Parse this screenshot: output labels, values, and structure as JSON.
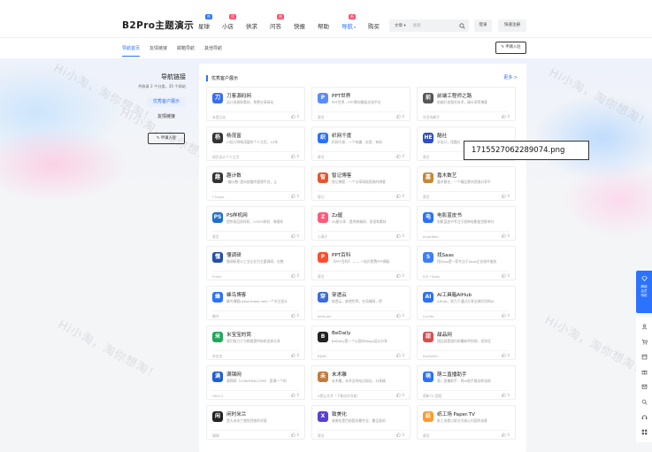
{
  "header": {
    "logo": "B2Pro主题演示",
    "nav": [
      {
        "label": "星球",
        "badge": "热门",
        "badge_color": "#2a72ff",
        "caret": false,
        "active": false
      },
      {
        "label": "小店",
        "badge": "优惠",
        "badge_color": "#ff4d6a",
        "caret": false,
        "active": false
      },
      {
        "label": "供求",
        "badge": "",
        "badge_color": "",
        "caret": false,
        "active": false
      },
      {
        "label": "问答",
        "badge": "热门",
        "badge_color": "#ff4d6a",
        "caret": false,
        "active": false
      },
      {
        "label": "快报",
        "badge": "",
        "badge_color": "",
        "caret": false,
        "active": false
      },
      {
        "label": "帮助",
        "badge": "",
        "badge_color": "",
        "caret": false,
        "active": false
      },
      {
        "label": "导航",
        "badge": "新",
        "badge_color": "#ff4d6a",
        "caret": true,
        "active": true
      },
      {
        "label": "购买",
        "badge": "",
        "badge_color": "",
        "caret": false,
        "active": false
      }
    ],
    "search_scope": "文章",
    "search_placeholder": "搜索",
    "login": "登录",
    "register": "快速注册"
  },
  "subnav": {
    "tabs": [
      "导航首页",
      "友情链接",
      "邮箱导航",
      "其他导航"
    ],
    "active_index": 0,
    "apply": "申请入驻"
  },
  "sidebar": {
    "title": "导航链接",
    "subtitle": "共收录 2 个分类，35 个网站",
    "items": [
      "优秀客户展示",
      "友情链接"
    ],
    "active_index": 0,
    "apply": "申请入驻"
  },
  "main": {
    "section_title": "优秀客户展示",
    "more": "更多 >",
    "cards": [
      {
        "title": "刀客源码网",
        "desc": "设计资源和素材，免费分享网站",
        "author": "未登记名",
        "likes": "0",
        "logo_text": "刀",
        "logo_color": "#3a6df0"
      },
      {
        "title": "PPT世界",
        "desc": "PPT世界 - PPT素材模板交流平台",
        "author": "慕言",
        "likes": "0",
        "logo_text": "P",
        "logo_color": "#5b8cff"
      },
      {
        "title": "前端工程师之路",
        "desc": "前端开发相关技术，精分享等博客",
        "author": "空灵的鹤子",
        "likes": "0",
        "logo_text": "前",
        "logo_color": "#555555"
      },
      {
        "title": "杨茂富",
        "desc": "UI设计师杨茂富的个人主页，10年",
        "author": "网页设计个人主页",
        "likes": "0",
        "logo_text": "杨",
        "logo_color": "#333333"
      },
      {
        "title": "织网千度",
        "desc": "织网千度 - 一个有趣、实用、有料",
        "author": "慕言",
        "likes": "0",
        "logo_text": "织",
        "logo_color": "#2a72ff"
      },
      {
        "title": "酷社",
        "desc": "学设计，找酷社",
        "author": "慕言",
        "likes": "0",
        "logo_text": "HE",
        "logo_color": "#2d4ec4"
      },
      {
        "title": "趣计数",
        "desc": "“趣计数”是向前看的管理平台，让",
        "author": "f Sugar",
        "likes": "0",
        "logo_text": "趣",
        "logo_color": "#333333"
      },
      {
        "title": "智记博客",
        "desc": "智记博客 - 一个分享网络资源的博客",
        "author": "智记",
        "likes": "0",
        "logo_text": "智",
        "logo_color": "#e4572e"
      },
      {
        "title": "嘉木数艺",
        "desc": "嘉木数艺，一个精品素材资源分享平",
        "author": "慕言",
        "likes": "0",
        "logo_text": "嘉",
        "logo_color": "#c48a3a"
      },
      {
        "title": "PS样机网",
        "desc": "提供高品质样机、LOGO样机、海报样",
        "author": "慕言",
        "likes": "0",
        "logo_text": "PS",
        "logo_color": "#1f6fd1"
      },
      {
        "title": "Zz屋",
        "desc": "Zz屋分享 - 提供前端网、发现和素材",
        "author": "小满子",
        "likes": "0",
        "logo_text": "Z",
        "logo_color": "#ff5a79"
      },
      {
        "title": "电影蓝皮书",
        "desc": "电影蓝皮书专注于经典电影鉴赏影单分",
        "author": "phaoWeo",
        "likes": "0",
        "logo_text": "电",
        "logo_color": "#2a72ff"
      },
      {
        "title": "懂调研",
        "desc": "懂调研是以工业企业为主要调研，在数",
        "author": "Frank",
        "likes": "0",
        "logo_text": "懂",
        "logo_color": "#2450a8"
      },
      {
        "title": "PPT百科",
        "desc": "【PPT百科】 —— 一站式免费PPT模板",
        "author": "慕言",
        "likes": "0",
        "logo_text": "P",
        "logo_color": "#ff4d2d"
      },
      {
        "title": "找Saas",
        "desc": "找Saas是一家专注于Saas企业软件服务",
        "author": "S小一Saas",
        "likes": "0",
        "logo_text": "S",
        "logo_color": "#3b7dff"
      },
      {
        "title": "蜂鸟博客",
        "desc": "蜂鸟博客(www.fnash.net)一个关注设计",
        "author": "蜂鸟",
        "likes": "0",
        "logo_text": "蜂",
        "logo_color": "#2a72ff"
      },
      {
        "title": "穿透云",
        "desc": "穿透云，穿透世界，在局域网，把",
        "author": "beihuan",
        "likes": "0",
        "logo_text": "穿",
        "logo_color": "#3b6cdb"
      },
      {
        "title": "AI工具箱AIHub",
        "desc": "AIHub，致力于通过分享全球好用的AI",
        "author": "Lucifer",
        "likes": "0",
        "logo_text": "AI",
        "logo_color": "#2a72ff"
      },
      {
        "title": "米宝宝的窝",
        "desc": "我们致力于为想要提供给机优质分享",
        "author": "米宝宝",
        "likes": "0",
        "logo_text": "米",
        "logo_color": "#1fa85a"
      },
      {
        "title": "BeDaily",
        "desc": "BeDaily是一个以国内Blogs设计分享",
        "author": "BDNC",
        "likes": "0",
        "logo_text": "B",
        "logo_color": "#222222"
      },
      {
        "title": "甜品网",
        "desc": "甜品网是国内的最新特别地，优质设",
        "author": "RouiWxin",
        "likes": "0",
        "logo_text": "甜",
        "logo_color": "#d94e4e"
      },
      {
        "title": "满锦网",
        "desc": "满锦网（CHAOPAN.COM）,是满一个的",
        "author": "HS412",
        "likes": "0",
        "logo_text": "满",
        "logo_color": "#1e5fd6"
      },
      {
        "title": "未术雕",
        "desc": "未术雕，未术全的站点网址，分享精",
        "author": "A赞云艺术（下载站外导航）",
        "likes": "0",
        "logo_text": "未",
        "logo_color": "#c37a3d"
      },
      {
        "title": "萌二直播助手",
        "desc": "萌二直播助手 - 将AI助手服务转化和",
        "author": "萌新TV 团组",
        "likes": "0",
        "logo_text": "萌",
        "logo_color": "#2a72ff"
      },
      {
        "title": "闲时米兰",
        "desc": "是大米米兰就找到他的对面",
        "author": "珊瑚",
        "likes": "0",
        "logo_text": "闲",
        "logo_color": "#222222"
      },
      {
        "title": "致美化",
        "desc": "致美化是目前国内最专业、最全面的",
        "author": "慕言",
        "likes": "0",
        "logo_text": "X",
        "logo_color": "#5a3fd1"
      },
      {
        "title": "纸工场 Paper.TV",
        "desc": "纸工场是以纸艺为核心内容的创意",
        "author": "慕言",
        "likes": "0",
        "logo_text": "纸",
        "logo_color": "#ff9a2e"
      }
    ]
  },
  "tooltip": "1715527062289074.png",
  "watermark": "Hi小淘，淘你想淘！",
  "right_bar": {
    "feature_label": "解锁\n会员\n特权",
    "icons": [
      "user-icon",
      "cart-icon",
      "card-icon",
      "gift-icon",
      "message-icon",
      "search-icon",
      "headset-icon",
      "grid-icon"
    ]
  }
}
